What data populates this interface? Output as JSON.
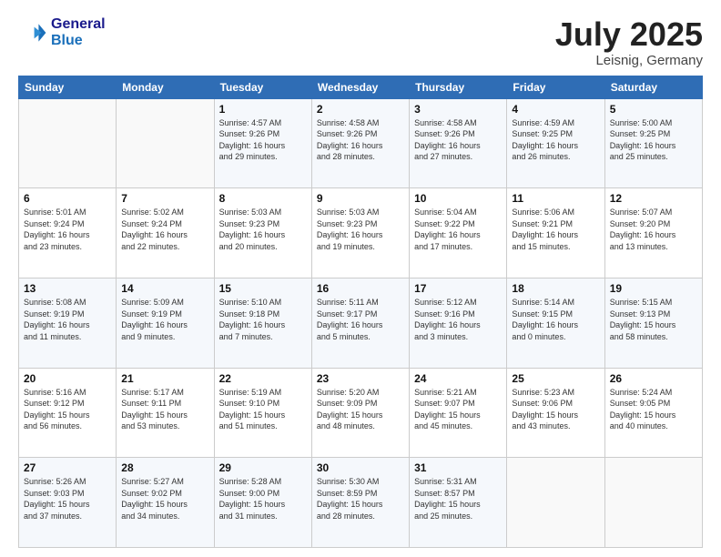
{
  "header": {
    "logo_line1": "General",
    "logo_line2": "Blue",
    "month": "July 2025",
    "location": "Leisnig, Germany"
  },
  "days_of_week": [
    "Sunday",
    "Monday",
    "Tuesday",
    "Wednesday",
    "Thursday",
    "Friday",
    "Saturday"
  ],
  "weeks": [
    [
      {
        "num": "",
        "detail": ""
      },
      {
        "num": "",
        "detail": ""
      },
      {
        "num": "1",
        "detail": "Sunrise: 4:57 AM\nSunset: 9:26 PM\nDaylight: 16 hours\nand 29 minutes."
      },
      {
        "num": "2",
        "detail": "Sunrise: 4:58 AM\nSunset: 9:26 PM\nDaylight: 16 hours\nand 28 minutes."
      },
      {
        "num": "3",
        "detail": "Sunrise: 4:58 AM\nSunset: 9:26 PM\nDaylight: 16 hours\nand 27 minutes."
      },
      {
        "num": "4",
        "detail": "Sunrise: 4:59 AM\nSunset: 9:25 PM\nDaylight: 16 hours\nand 26 minutes."
      },
      {
        "num": "5",
        "detail": "Sunrise: 5:00 AM\nSunset: 9:25 PM\nDaylight: 16 hours\nand 25 minutes."
      }
    ],
    [
      {
        "num": "6",
        "detail": "Sunrise: 5:01 AM\nSunset: 9:24 PM\nDaylight: 16 hours\nand 23 minutes."
      },
      {
        "num": "7",
        "detail": "Sunrise: 5:02 AM\nSunset: 9:24 PM\nDaylight: 16 hours\nand 22 minutes."
      },
      {
        "num": "8",
        "detail": "Sunrise: 5:03 AM\nSunset: 9:23 PM\nDaylight: 16 hours\nand 20 minutes."
      },
      {
        "num": "9",
        "detail": "Sunrise: 5:03 AM\nSunset: 9:23 PM\nDaylight: 16 hours\nand 19 minutes."
      },
      {
        "num": "10",
        "detail": "Sunrise: 5:04 AM\nSunset: 9:22 PM\nDaylight: 16 hours\nand 17 minutes."
      },
      {
        "num": "11",
        "detail": "Sunrise: 5:06 AM\nSunset: 9:21 PM\nDaylight: 16 hours\nand 15 minutes."
      },
      {
        "num": "12",
        "detail": "Sunrise: 5:07 AM\nSunset: 9:20 PM\nDaylight: 16 hours\nand 13 minutes."
      }
    ],
    [
      {
        "num": "13",
        "detail": "Sunrise: 5:08 AM\nSunset: 9:19 PM\nDaylight: 16 hours\nand 11 minutes."
      },
      {
        "num": "14",
        "detail": "Sunrise: 5:09 AM\nSunset: 9:19 PM\nDaylight: 16 hours\nand 9 minutes."
      },
      {
        "num": "15",
        "detail": "Sunrise: 5:10 AM\nSunset: 9:18 PM\nDaylight: 16 hours\nand 7 minutes."
      },
      {
        "num": "16",
        "detail": "Sunrise: 5:11 AM\nSunset: 9:17 PM\nDaylight: 16 hours\nand 5 minutes."
      },
      {
        "num": "17",
        "detail": "Sunrise: 5:12 AM\nSunset: 9:16 PM\nDaylight: 16 hours\nand 3 minutes."
      },
      {
        "num": "18",
        "detail": "Sunrise: 5:14 AM\nSunset: 9:15 PM\nDaylight: 16 hours\nand 0 minutes."
      },
      {
        "num": "19",
        "detail": "Sunrise: 5:15 AM\nSunset: 9:13 PM\nDaylight: 15 hours\nand 58 minutes."
      }
    ],
    [
      {
        "num": "20",
        "detail": "Sunrise: 5:16 AM\nSunset: 9:12 PM\nDaylight: 15 hours\nand 56 minutes."
      },
      {
        "num": "21",
        "detail": "Sunrise: 5:17 AM\nSunset: 9:11 PM\nDaylight: 15 hours\nand 53 minutes."
      },
      {
        "num": "22",
        "detail": "Sunrise: 5:19 AM\nSunset: 9:10 PM\nDaylight: 15 hours\nand 51 minutes."
      },
      {
        "num": "23",
        "detail": "Sunrise: 5:20 AM\nSunset: 9:09 PM\nDaylight: 15 hours\nand 48 minutes."
      },
      {
        "num": "24",
        "detail": "Sunrise: 5:21 AM\nSunset: 9:07 PM\nDaylight: 15 hours\nand 45 minutes."
      },
      {
        "num": "25",
        "detail": "Sunrise: 5:23 AM\nSunset: 9:06 PM\nDaylight: 15 hours\nand 43 minutes."
      },
      {
        "num": "26",
        "detail": "Sunrise: 5:24 AM\nSunset: 9:05 PM\nDaylight: 15 hours\nand 40 minutes."
      }
    ],
    [
      {
        "num": "27",
        "detail": "Sunrise: 5:26 AM\nSunset: 9:03 PM\nDaylight: 15 hours\nand 37 minutes."
      },
      {
        "num": "28",
        "detail": "Sunrise: 5:27 AM\nSunset: 9:02 PM\nDaylight: 15 hours\nand 34 minutes."
      },
      {
        "num": "29",
        "detail": "Sunrise: 5:28 AM\nSunset: 9:00 PM\nDaylight: 15 hours\nand 31 minutes."
      },
      {
        "num": "30",
        "detail": "Sunrise: 5:30 AM\nSunset: 8:59 PM\nDaylight: 15 hours\nand 28 minutes."
      },
      {
        "num": "31",
        "detail": "Sunrise: 5:31 AM\nSunset: 8:57 PM\nDaylight: 15 hours\nand 25 minutes."
      },
      {
        "num": "",
        "detail": ""
      },
      {
        "num": "",
        "detail": ""
      }
    ]
  ]
}
